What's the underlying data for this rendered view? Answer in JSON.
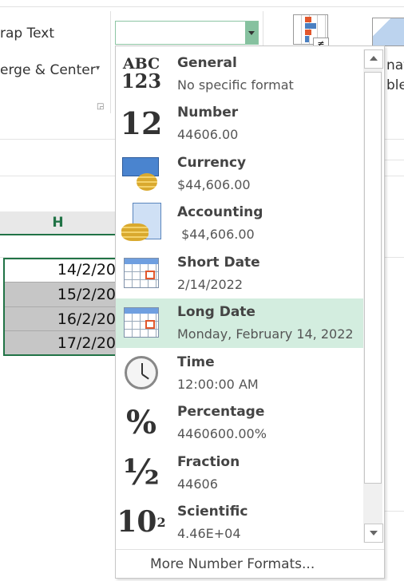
{
  "ribbon": {
    "wrap_text": "rap Text",
    "merge_center": "erge & Center",
    "number_format_value": "",
    "right_text_1": "nat",
    "right_text_2": "ble"
  },
  "sheet": {
    "column_header": "H",
    "cells": [
      "14/2/20",
      "15/2/20",
      "16/2/20",
      "17/2/20"
    ]
  },
  "dropdown": {
    "items": [
      {
        "label": "General",
        "example": "No specific format",
        "icon": "abc-123-icon"
      },
      {
        "label": "Number",
        "example": "44606.00",
        "icon": "number-12-icon"
      },
      {
        "label": "Currency",
        "example": "$44,606.00",
        "icon": "currency-icon"
      },
      {
        "label": "Accounting",
        "example": " $44,606.00",
        "icon": "accounting-icon"
      },
      {
        "label": "Short Date",
        "example": "2/14/2022",
        "icon": "calendar-icon"
      },
      {
        "label": "Long Date",
        "example": "Monday, February 14, 2022",
        "icon": "calendar-icon",
        "highlighted": true
      },
      {
        "label": "Time",
        "example": "12:00:00 AM",
        "icon": "clock-icon"
      },
      {
        "label": "Percentage",
        "example": "4460600.00%",
        "icon": "percent-icon"
      },
      {
        "label": "Fraction",
        "example": "44606",
        "icon": "fraction-icon"
      },
      {
        "label": "Scientific",
        "example": "4.46E+04",
        "icon": "scientific-icon"
      }
    ],
    "more_formats": "More Number Formats...",
    "highlight_color": "#d3eddf"
  },
  "icon_text": {
    "abc": "ABC",
    "n123": "123",
    "twelve": "12",
    "pct": "%",
    "half": "½",
    "ten": "10",
    "sup": "2"
  }
}
